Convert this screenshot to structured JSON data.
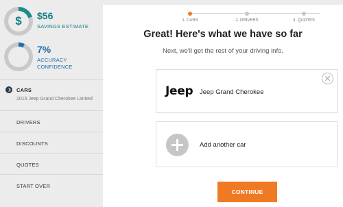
{
  "sidebar": {
    "savings": {
      "icon": "$",
      "value": "$56",
      "label": "SAVINGS ESTIMATE",
      "color": "#0f7f82",
      "fill": 0.2
    },
    "accuracy": {
      "value": "7%",
      "label_line1": "ACCURACY",
      "label_line2": "CONFIDENCE",
      "color": "#1f6fa8",
      "fill": 0.07
    },
    "nav": [
      {
        "label": "CARS",
        "sub": "2015 Jeep Grand Cherokee Limited",
        "active": true
      },
      {
        "label": "DRIVERS"
      },
      {
        "label": "DISCOUNTS"
      },
      {
        "label": "QUOTES"
      },
      {
        "label": "START OVER"
      }
    ]
  },
  "progress": {
    "steps": [
      "1. CARS",
      "2. DRIVERS",
      "3. QUOTES"
    ],
    "active_index": 0,
    "active_color": "#ef7d2d"
  },
  "main": {
    "title": "Great! Here's what we have so far",
    "subtitle": "Next, we'll get the rest of your driving info.",
    "car": {
      "logo": "Jeep",
      "name": "Jeep Grand Cherokee"
    },
    "add_car_label": "Add another car",
    "continue_label": "CONTINUE",
    "continue_color": "#f07a24"
  }
}
